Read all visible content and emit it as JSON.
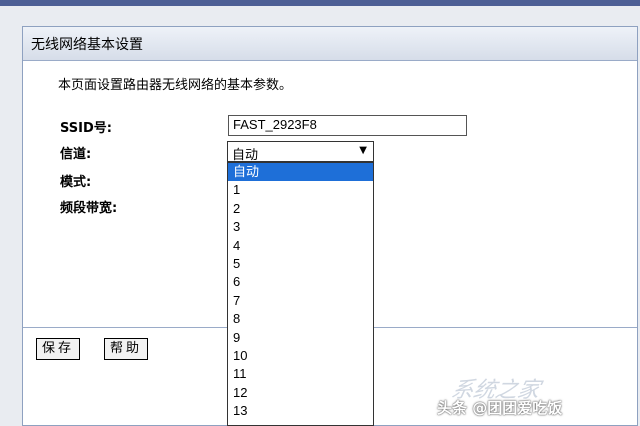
{
  "panel": {
    "title": "无线网络基本设置",
    "description": "本页面设置路由器无线网络的基本参数。"
  },
  "form": {
    "ssid_label": "SSID号:",
    "ssid_value": "FAST_2923F8",
    "channel_label": "信道:",
    "channel_selected": "自动",
    "mode_label": "模式:",
    "bandwidth_label": "频段带宽:"
  },
  "channel_options": [
    "自动",
    "1",
    "2",
    "3",
    "4",
    "5",
    "6",
    "7",
    "8",
    "9",
    "10",
    "11",
    "12",
    "13"
  ],
  "buttons": {
    "save": "保存",
    "help": "帮助"
  },
  "watermark": {
    "text": "头条 @团团爱吃饭",
    "faint_text": "系统之家"
  },
  "colors": {
    "selected_highlight": "#1e6fd8",
    "panel_border": "#8ea1c0",
    "top_strip": "#4d5f95"
  },
  "icons": {
    "select_arrow": "triangle-down"
  }
}
